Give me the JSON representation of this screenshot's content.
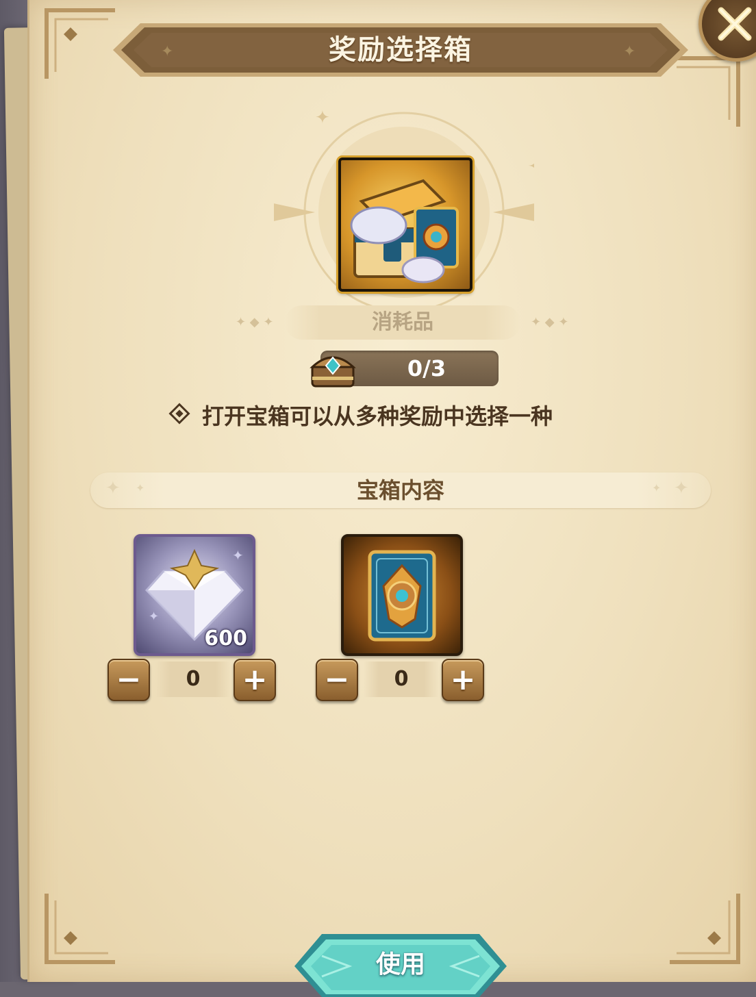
{
  "dialog": {
    "title": "奖励选择箱",
    "close_label": "close"
  },
  "featured": {
    "icon": "treasure-chest-icon",
    "category": "消耗品",
    "counter": "0/3",
    "description": "打开宝箱可以从多种奖励中选择一种"
  },
  "contents": {
    "section_title": "宝箱内容",
    "items": [
      {
        "icon": "diamond-gem-icon",
        "amount": "600",
        "quantity": "0",
        "minus_label": "−",
        "plus_label": "+"
      },
      {
        "icon": "card-back-icon",
        "amount": "",
        "quantity": "0",
        "minus_label": "−",
        "plus_label": "+"
      }
    ]
  },
  "footer": {
    "use_label": "使用"
  },
  "colors": {
    "title_bar": "#7c5e3a",
    "panel": "#efe0bd",
    "accent_teal": "#5fd0c4",
    "text_dark": "#4a3520"
  }
}
